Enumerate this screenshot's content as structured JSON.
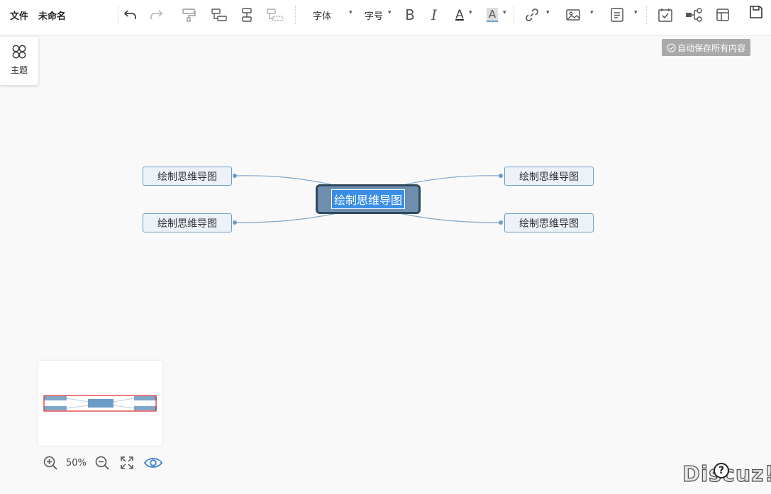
{
  "menu": {
    "file": "文件",
    "doc_name": "未命名"
  },
  "toolbar": {
    "font_label": "字体",
    "size_label": "字号",
    "bold": "B",
    "italic": "I",
    "font_color": "A",
    "highlight": "A",
    "accent_color": "#3b8ee6"
  },
  "theme": {
    "label": "主题"
  },
  "status": {
    "autosave": "自动保存所有内容"
  },
  "mindmap": {
    "root": "绘制思维导图",
    "nodes": [
      "绘制思维导图",
      "绘制思维导图",
      "绘制思维导图",
      "绘制思维导图"
    ]
  },
  "zoom": {
    "value": "50%"
  },
  "help": {
    "label": "?"
  },
  "watermark": "Discuz!"
}
